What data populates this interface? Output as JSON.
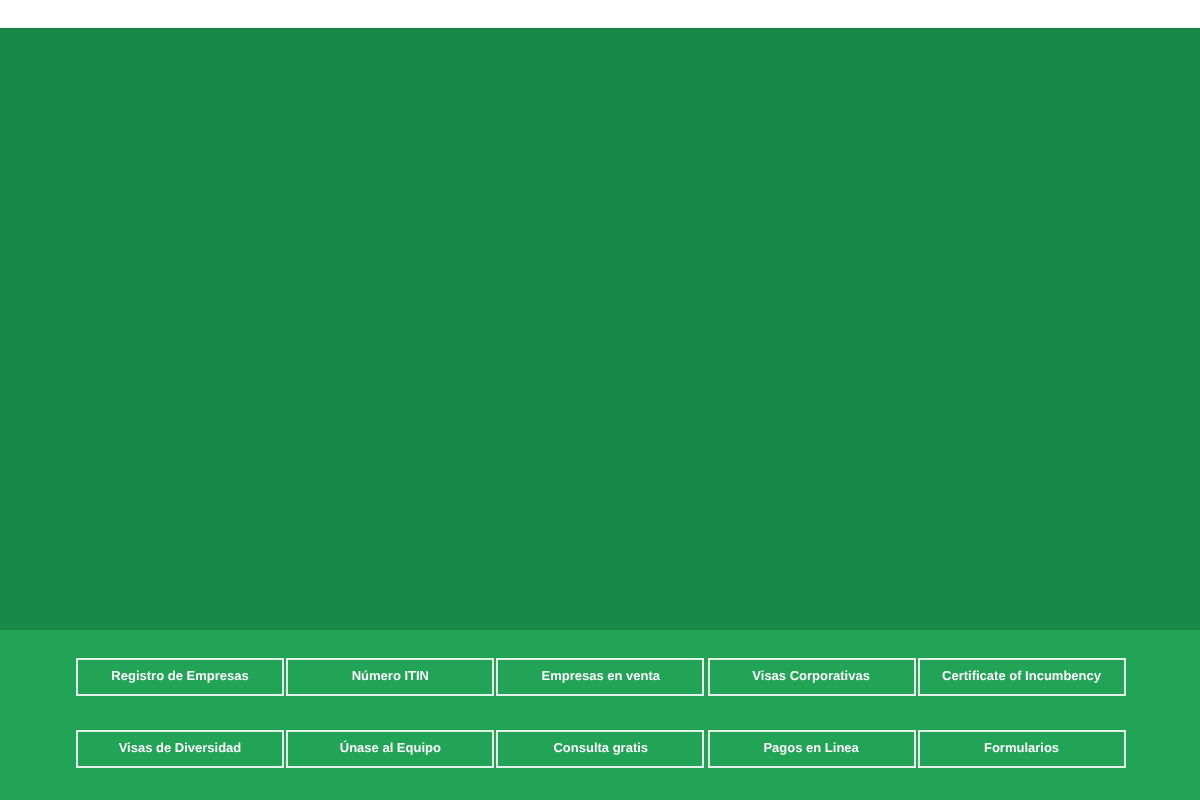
{
  "links": [
    {
      "label": "Registro de Empresas"
    },
    {
      "label": "Número ITIN"
    },
    {
      "label": "Empresas en venta"
    },
    {
      "label": "Visas Corporativas"
    },
    {
      "label": "Certificate of Incumbency"
    },
    {
      "label": "Visas de Diversidad"
    },
    {
      "label": "Únase al Equipo"
    },
    {
      "label": "Consulta gratis"
    },
    {
      "label": "Pagos en Linea"
    },
    {
      "label": "Formularios"
    }
  ]
}
